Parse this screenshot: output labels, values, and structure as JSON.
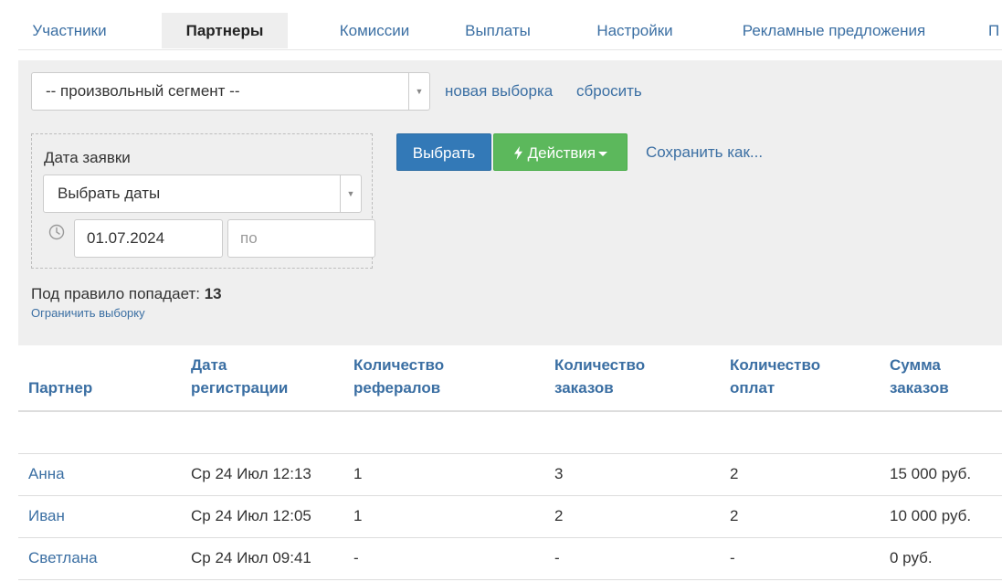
{
  "tabs": [
    {
      "label": "Участники",
      "active": false
    },
    {
      "label": "Партнеры",
      "active": true
    },
    {
      "label": "Комиссии",
      "active": false
    },
    {
      "label": "Выплаты",
      "active": false
    },
    {
      "label": "Настройки",
      "active": false
    },
    {
      "label": "Рекламные предложения",
      "active": false
    },
    {
      "label": "П",
      "active": false
    }
  ],
  "filter": {
    "segment_value": "-- произвольный сегмент --",
    "new_selection_link": "новая выборка",
    "reset_link": "сбросить",
    "date_label": "Дата заявки",
    "date_select_value": "Выбрать даты",
    "date_from": "01.07.2024",
    "date_to_placeholder": "по",
    "select_button": "Выбрать",
    "actions_button": "Действия",
    "save_as_link": "Сохранить как...",
    "rule_text": "Под правило попадает:",
    "rule_count": "13",
    "limit_link": "Ограничить выборку"
  },
  "table": {
    "headers": {
      "partner": "Партнер",
      "reg_date_line1": "Дата",
      "reg_date_line2": "регистрации",
      "referrals_line1": "Количество",
      "referrals_line2": "рефералов",
      "orders_line1": "Количество",
      "orders_line2": "заказов",
      "payments_line1": "Количество",
      "payments_line2": "оплат",
      "sum_line1": "Сумма",
      "sum_line2": "заказов"
    },
    "rows": [
      {
        "name": "Анна",
        "date": "Ср 24 Июл 12:13",
        "referrals": "1",
        "orders": "3",
        "payments": "2",
        "sum": "15 000 руб."
      },
      {
        "name": "Иван",
        "date": "Ср 24 Июл 12:05",
        "referrals": "1",
        "orders": "2",
        "payments": "2",
        "sum": "10 000 руб."
      },
      {
        "name": "Светлана",
        "date": "Ср 24 Июл 09:41",
        "referrals": "-",
        "orders": "-",
        "payments": "-",
        "sum": "0 руб."
      }
    ]
  },
  "icons": {
    "clock": "clock-icon",
    "bolt": "lightning-icon",
    "dropdown": "chevron-down-icon"
  },
  "colors": {
    "link": "#3b6fa3",
    "primary": "#3379b7",
    "success": "#5cb85c",
    "panel": "#efefef"
  }
}
